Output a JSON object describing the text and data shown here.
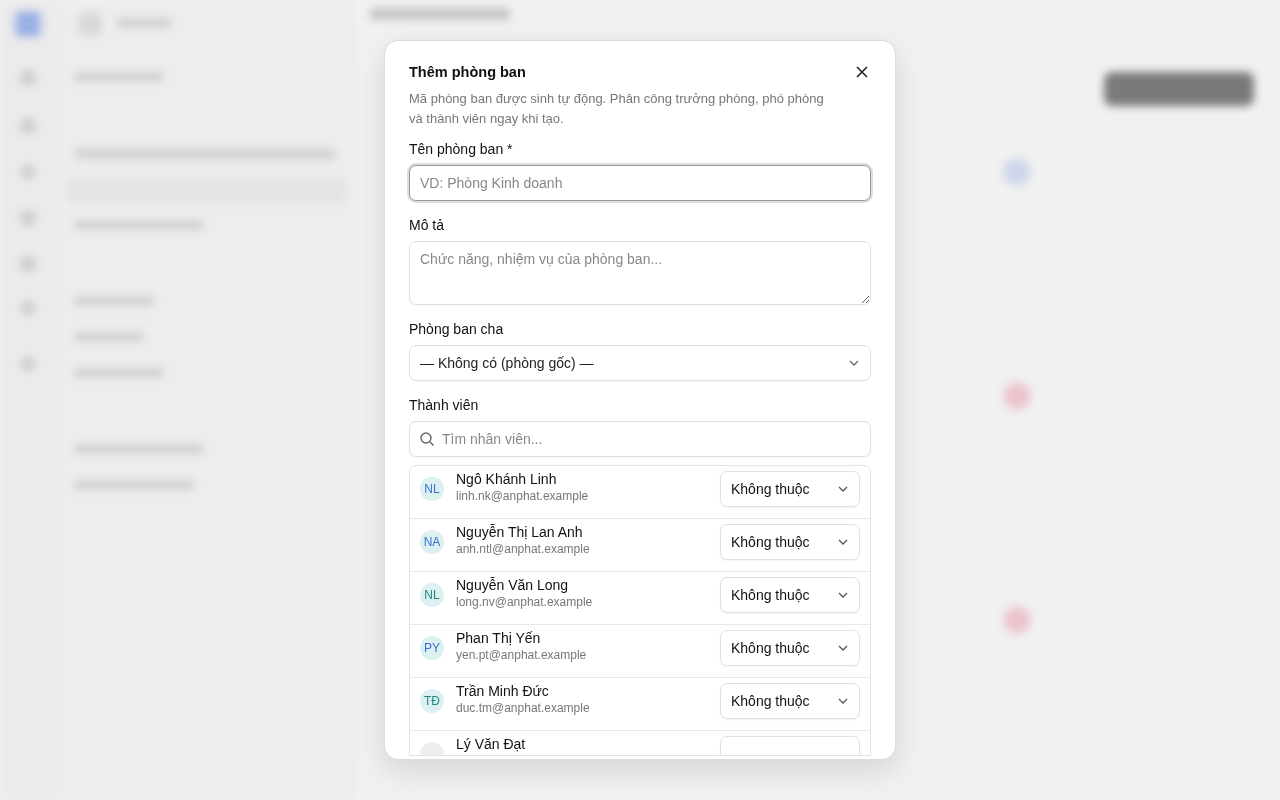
{
  "dialog": {
    "title": "Thêm phòng ban",
    "description": "Mã phòng ban được sinh tự động. Phân công trưởng phòng, phó phòng và thành viên ngay khi tạo.",
    "name_field": {
      "label": "Tên phòng ban *",
      "placeholder": "VD: Phòng Kinh doanh"
    },
    "description_field": {
      "label": "Mô tả",
      "placeholder": "Chức năng, nhiệm vụ của phòng ban..."
    },
    "parent_field": {
      "label": "Phòng ban cha",
      "value": "— Không có (phòng gốc) —"
    },
    "members": {
      "label": "Thành viên",
      "search_placeholder": "Tìm nhân viên...",
      "rows": [
        {
          "initials": "NL",
          "color": "#3a6fd0",
          "name": "Ngô Khánh Linh",
          "email": "linh.nk@anphat.example",
          "role": "Không thuộc"
        },
        {
          "initials": "NA",
          "color": "#3a6fd0",
          "name": "Nguyễn Thị Lan Anh",
          "email": "anh.ntl@anphat.example",
          "role": "Không thuộc"
        },
        {
          "initials": "NL",
          "color": "#1f8a78",
          "name": "Nguyễn Văn Long",
          "email": "long.nv@anphat.example",
          "role": "Không thuộc"
        },
        {
          "initials": "PY",
          "color": "#3a6fd0",
          "name": "Phan Thị Yến",
          "email": "yen.pt@anphat.example",
          "role": "Không thuộc"
        },
        {
          "initials": "TĐ",
          "color": "#1f8a78",
          "name": "Trần Minh Đức",
          "email": "duc.tm@anphat.example",
          "role": "Không thuộc"
        },
        {
          "name": "Lý Văn Đạt"
        }
      ]
    }
  }
}
